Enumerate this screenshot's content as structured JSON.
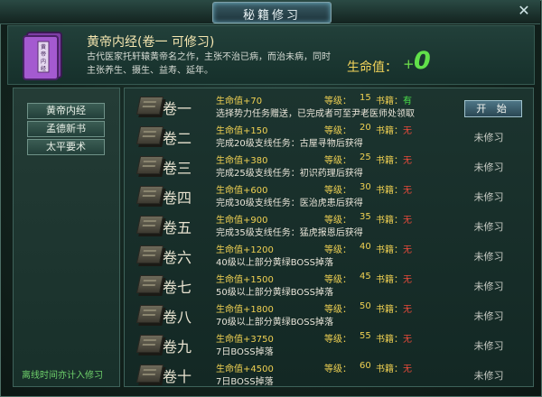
{
  "window": {
    "title": "秘籍修习"
  },
  "book": {
    "name": "黄帝内经(卷一   可修习)",
    "description": "古代医家托轩辕黄帝名之作，主张不治已病，而治未病，同时主张养生、摄生、益寿、延年。",
    "cover_text": "黄帝内经",
    "life_label": "生命值：",
    "life_plus": "+",
    "life_value": "0"
  },
  "sidebar": {
    "items": [
      {
        "label": "黄帝内经"
      },
      {
        "label": "孟德新书"
      },
      {
        "label": "太平要术"
      }
    ],
    "footer": "离线时间亦计入修习"
  },
  "labels": {
    "level": "等级：",
    "book": "书籍："
  },
  "colors": {
    "has": "#4be04a",
    "none": "#e84a3a"
  },
  "start_button": "开 始",
  "volumes": [
    {
      "name": "卷一",
      "life": "生命值+70",
      "level": "15",
      "book": "有",
      "desc": "选择势力任务赠送，已完成者可至尹老医师处领取",
      "status": ""
    },
    {
      "name": "卷二",
      "life": "生命值+150",
      "level": "20",
      "book": "无",
      "desc": "完成20级支线任务：古屋寻物后获得",
      "status": "未修习"
    },
    {
      "name": "卷三",
      "life": "生命值+380",
      "level": "25",
      "book": "无",
      "desc": "完成25级支线任务：初识药理后获得",
      "status": "未修习"
    },
    {
      "name": "卷四",
      "life": "生命值+600",
      "level": "30",
      "book": "无",
      "desc": "完成30级支线任务：医治虎患后获得",
      "status": "未修习"
    },
    {
      "name": "卷五",
      "life": "生命值+900",
      "level": "35",
      "book": "无",
      "desc": "完成35级支线任务：猛虎报恩后获得",
      "status": "未修习"
    },
    {
      "name": "卷六",
      "life": "生命值+1200",
      "level": "40",
      "book": "无",
      "desc": "40级以上部分黄绿BOSS掉落",
      "status": "未修习"
    },
    {
      "name": "卷七",
      "life": "生命值+1500",
      "level": "45",
      "book": "无",
      "desc": "50级以上部分黄绿BOSS掉落",
      "status": "未修习"
    },
    {
      "name": "卷八",
      "life": "生命值+1800",
      "level": "50",
      "book": "无",
      "desc": "70级以上部分黄绿BOSS掉落",
      "status": "未修习"
    },
    {
      "name": "卷九",
      "life": "生命值+3750",
      "level": "55",
      "book": "无",
      "desc": "7日BOSS掉落",
      "status": "未修习"
    },
    {
      "name": "卷十",
      "life": "生命值+4500",
      "level": "60",
      "book": "无",
      "desc": "7日BOSS掉落",
      "status": "未修习"
    }
  ]
}
